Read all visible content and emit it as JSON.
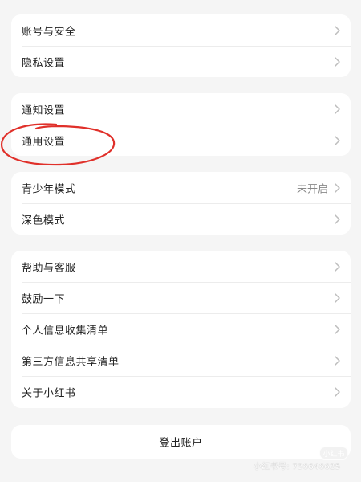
{
  "settings": {
    "groups": [
      {
        "items": [
          {
            "label": "账号与安全"
          },
          {
            "label": "隐私设置"
          }
        ]
      },
      {
        "items": [
          {
            "label": "通知设置"
          },
          {
            "label": "通用设置"
          }
        ]
      },
      {
        "items": [
          {
            "label": "青少年模式",
            "value": "未开启"
          },
          {
            "label": "深色模式"
          }
        ]
      },
      {
        "items": [
          {
            "label": "帮助与客服"
          },
          {
            "label": "鼓励一下"
          },
          {
            "label": "个人信息收集清单"
          },
          {
            "label": "第三方信息共享清单"
          },
          {
            "label": "关于小红书"
          }
        ]
      }
    ],
    "logout_label": "登出账户"
  },
  "annotation": {
    "color": "#e0302a"
  },
  "watermark": {
    "logo_text": "小红书",
    "text": "小红书号: 736646625"
  }
}
